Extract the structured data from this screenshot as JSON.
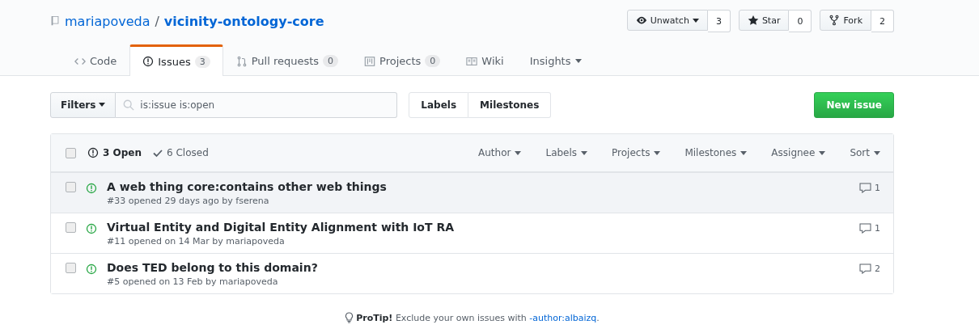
{
  "repo": {
    "owner": "mariapoveda",
    "separator": "/",
    "name": "vicinity-ontology-core"
  },
  "actions": [
    {
      "label": "Unwatch",
      "count": "3"
    },
    {
      "label": "Star",
      "count": "0"
    },
    {
      "label": "Fork",
      "count": "2"
    }
  ],
  "tabs": [
    {
      "label": "Code",
      "selected": false
    },
    {
      "label": "Issues",
      "counter": "3",
      "selected": true
    },
    {
      "label": "Pull requests",
      "counter": "0",
      "selected": false
    },
    {
      "label": "Projects",
      "counter": "0",
      "selected": false
    },
    {
      "label": "Wiki",
      "selected": false
    },
    {
      "label": "Insights",
      "selected": false
    }
  ],
  "filters": {
    "button": "Filters",
    "search": {
      "value": "is:issue is:open"
    },
    "nav": [
      "Labels",
      "Milestones"
    ],
    "new_button": "New issue"
  },
  "issues_header": {
    "checked": false,
    "open": "3 Open",
    "closed": "6 Closed",
    "menus": [
      "Author",
      "Labels",
      "Projects",
      "Milestones",
      "Assignee",
      "Sort"
    ]
  },
  "issues": [
    {
      "title": "A web thing core:contains other web things",
      "meta": "#33 opened 29 days ago by fserena",
      "comments": "1",
      "checked": false,
      "highlighted": true
    },
    {
      "title": "Virtual Entity and Digital Entity Alignment with IoT RA",
      "meta": "#11 opened on 14 Mar by mariapoveda",
      "comments": "1",
      "checked": false,
      "highlighted": false
    },
    {
      "title": "Does TED belong to this domain?",
      "meta": "#5 opened on 13 Feb by mariapoveda",
      "comments": "2",
      "checked": false,
      "highlighted": false
    }
  ],
  "protip": {
    "text": "**ProTip!** Exclude your own issues with ",
    "link": "-author:albaizq",
    "after": "."
  }
}
